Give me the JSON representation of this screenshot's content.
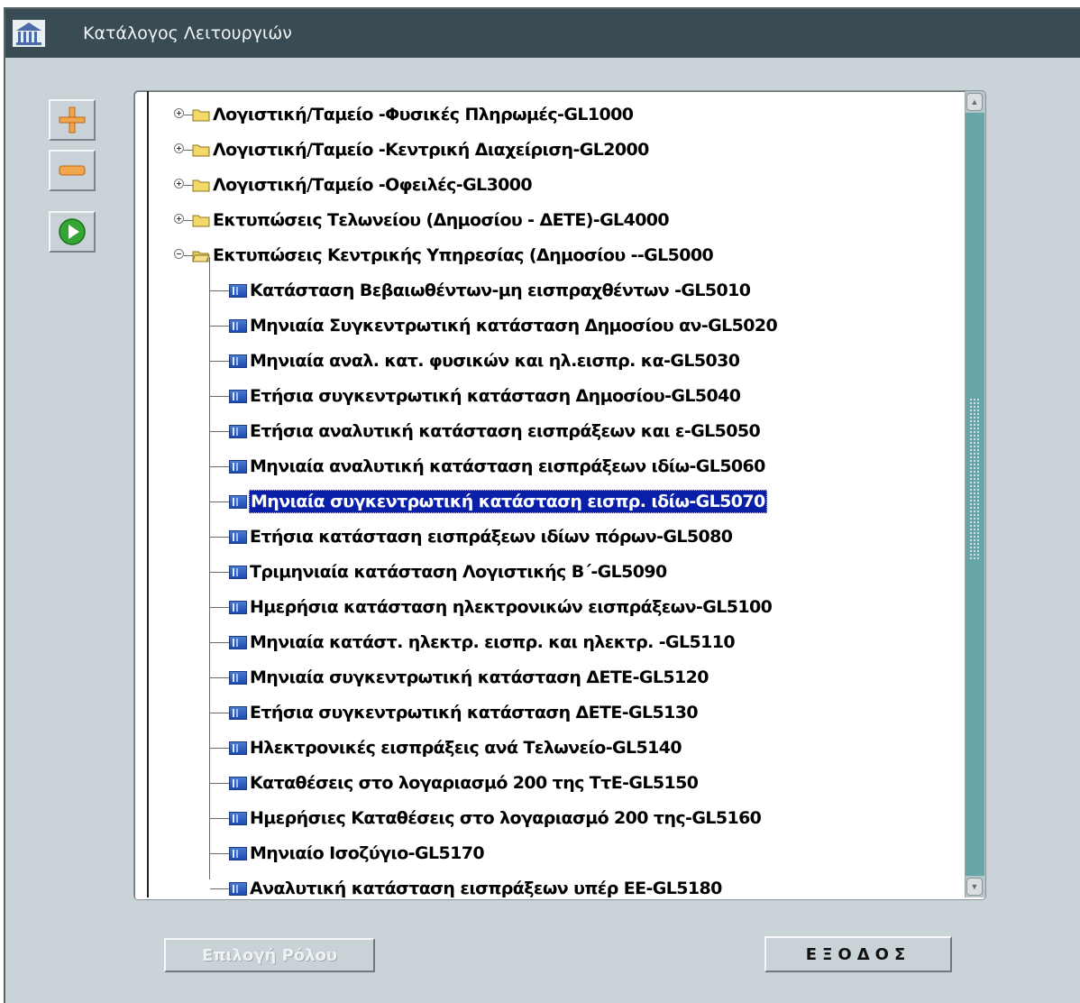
{
  "window": {
    "title": "Κατάλογος Λειτουργιών"
  },
  "toolbar": [
    {
      "name": "expand-all-button",
      "icon": "plus-icon"
    },
    {
      "name": "collapse-all-button",
      "icon": "minus-icon"
    },
    {
      "name": "run-button",
      "icon": "play-icon"
    }
  ],
  "tree": {
    "folders": [
      {
        "label": "Λογιστική/Ταμείο -Φυσικές Πληρωμές-GL1000",
        "expanded": false
      },
      {
        "label": "Λογιστική/Ταμείο -Κεντρική Διαχείριση-GL2000",
        "expanded": false
      },
      {
        "label": "Λογιστική/Ταμείο -Οφειλές-GL3000",
        "expanded": false
      },
      {
        "label": "Εκτυπώσεις  Τελωνείου (Δημοσίου - ΔΕΤΕ)-GL4000",
        "expanded": false
      },
      {
        "label": "Εκτυπώσεις  Κεντρικής Υπηρεσίας (Δημοσίου --GL5000",
        "expanded": true
      }
    ],
    "items": [
      {
        "label": "Κατάσταση Βεβαιωθέντων-μη εισπραχθέντων -GL5010"
      },
      {
        "label": "Μηνιαία Συγκεντρωτική κατάσταση Δημοσίου αν-GL5020"
      },
      {
        "label": "Μηνιαία αναλ. κατ. φυσικών και ηλ.εισπρ. κα-GL5030"
      },
      {
        "label": "Ετήσια συγκεντρωτική κατάσταση Δημοσίου-GL5040"
      },
      {
        "label": "Ετήσια αναλυτική κατάσταση εισπράξεων και ε-GL5050"
      },
      {
        "label": "Μηνιαία αναλυτική κατάσταση εισπράξεων ιδίω-GL5060"
      },
      {
        "label": "Μηνιαία συγκεντρωτική κατάσταση εισπρ. ιδίω-GL5070",
        "selected": true
      },
      {
        "label": "Ετήσια κατάσταση εισπράξεων ιδίων πόρων-GL5080"
      },
      {
        "label": "Τριμηνιαία κατάσταση Λογιστικής Β΄-GL5090"
      },
      {
        "label": "Ημερήσια κατάσταση ηλεκτρονικών εισπράξεων-GL5100"
      },
      {
        "label": "Μηνιαία κατάστ. ηλεκτρ. εισπρ. και ηλεκτρ. -GL5110"
      },
      {
        "label": "Μηνιαία συγκεντρωτική κατάσταση ΔΕΤΕ-GL5120"
      },
      {
        "label": "Ετήσια συγκεντρωτική κατάσταση ΔΕΤΕ-GL5130"
      },
      {
        "label": "Ηλεκτρονικές εισπράξεις ανά Τελωνείο-GL5140"
      },
      {
        "label": "Καταθέσεις στο λογαριασμό 200 της ΤτΕ-GL5150"
      },
      {
        "label": "Ημερήσιες Καταθέσεις στο λογαριασμό 200 της-GL5160"
      },
      {
        "label": "Μηνιαίο Ισοζύγιο-GL5170"
      },
      {
        "label": "Αναλυτική κατάσταση εισπράξεων υπέρ ΕΕ-GL5180"
      }
    ]
  },
  "buttons": {
    "role_select": "Επιλογή Ρόλου",
    "exit": "ΕΞΟΔΟΣ"
  },
  "colors": {
    "titlebar": "#394c54",
    "window_bg": "#cad4d8",
    "selection": "#0a1fa8",
    "scroll_thumb": "#66a6a8"
  }
}
